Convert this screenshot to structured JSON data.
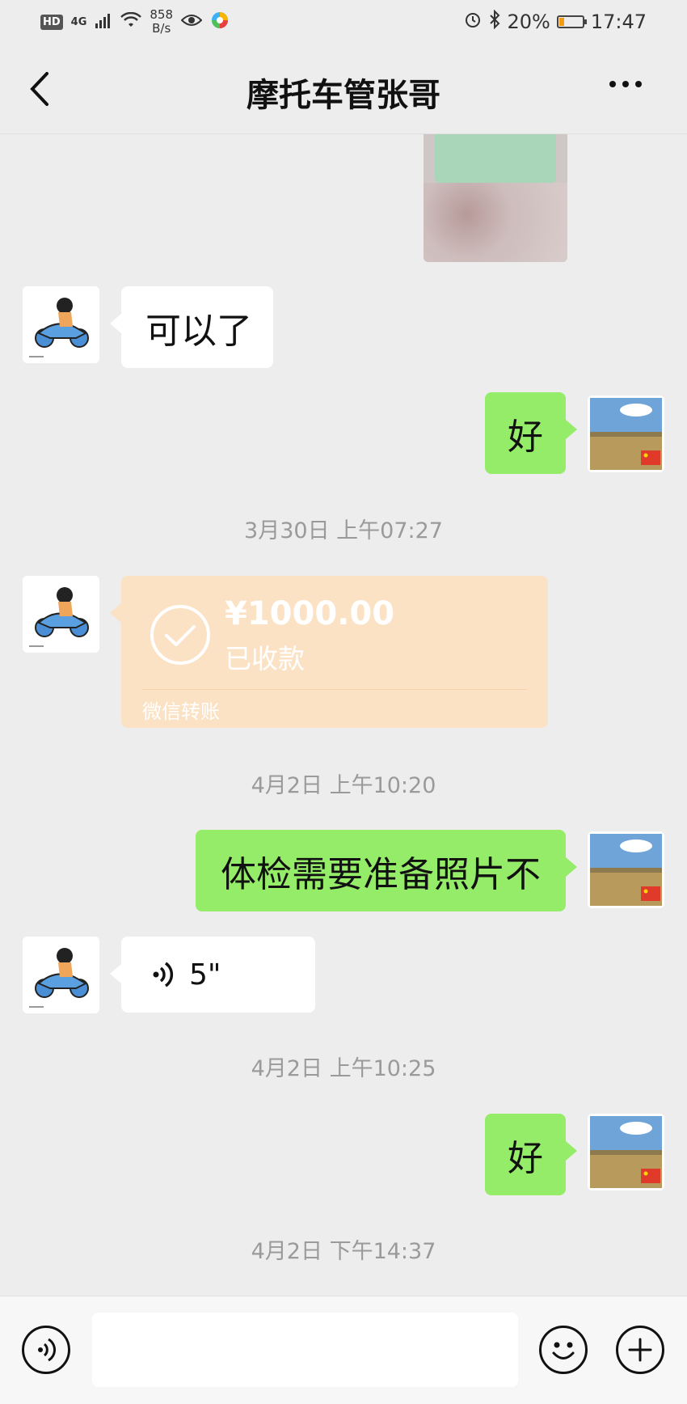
{
  "status_bar": {
    "hd": "HD",
    "network": "4G",
    "speed_value": "858",
    "speed_unit": "B/s",
    "battery_percent": "20%",
    "time": "17:47",
    "battery_level": 0.2
  },
  "header": {
    "title": "摩托车管张哥"
  },
  "messages": [
    {
      "sender": "other",
      "type": "text",
      "text": "可以了"
    },
    {
      "sender": "self",
      "type": "text",
      "text": "好"
    },
    {
      "type": "timestamp",
      "text": "3月30日 上午07:27"
    },
    {
      "sender": "other",
      "type": "transfer",
      "amount": "¥1000.00",
      "status": "已收款",
      "label": "微信转账"
    },
    {
      "type": "timestamp",
      "text": "4月2日 上午10:20"
    },
    {
      "sender": "self",
      "type": "text",
      "text": "体检需要准备照片不"
    },
    {
      "sender": "other",
      "type": "voice",
      "duration": "5\""
    },
    {
      "type": "timestamp",
      "text": "4月2日 上午10:25"
    },
    {
      "sender": "self",
      "type": "text",
      "text": "好"
    },
    {
      "type": "timestamp",
      "text": "4月2日 下午14:37"
    }
  ],
  "input_bar": {
    "text_value": ""
  },
  "colors": {
    "background": "#ededed",
    "self_bubble": "#95ec69",
    "other_bubble": "#ffffff",
    "transfer_bubble": "#fce2c4",
    "timestamp": "#9a9a9a"
  }
}
